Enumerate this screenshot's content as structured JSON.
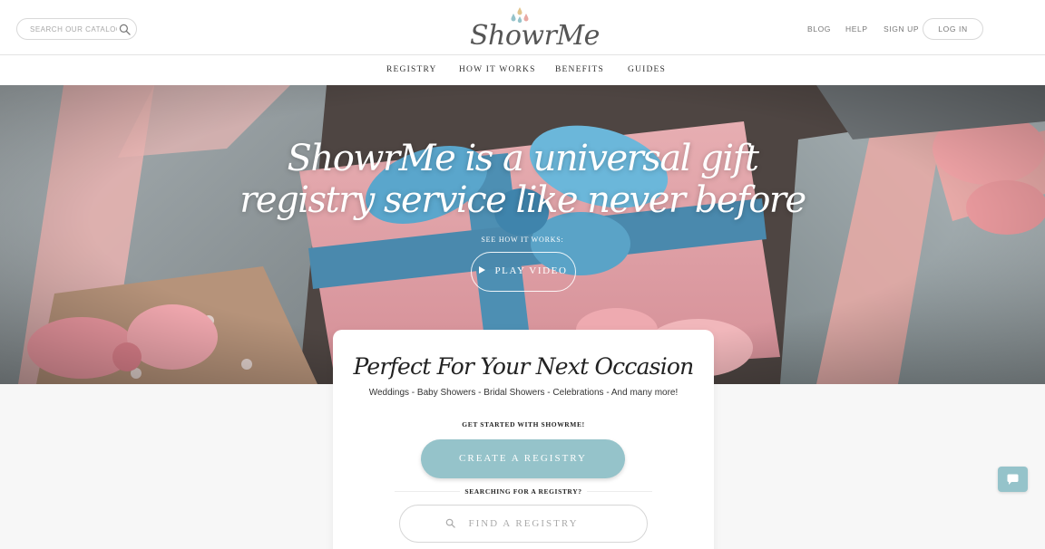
{
  "header": {
    "search_placeholder": "SEARCH OUR CATALOG",
    "logo_text": "ShowrMe",
    "links": [
      "BLOG",
      "HELP",
      "SIGN UP"
    ],
    "login_label": "LOG IN"
  },
  "subnav": [
    "REGISTRY",
    "HOW IT WORKS",
    "BENEFITS",
    "GUIDES"
  ],
  "hero": {
    "title_line1": "ShowrMe is a universal gift",
    "title_line2": "registry service like never before",
    "sub": "SEE HOW IT WORKS:",
    "play_label": "PLAY VIDEO"
  },
  "card": {
    "title": "Perfect For Your Next Occasion",
    "subtitle": "Weddings - Baby Showers - Bridal Showers - Celebrations - And many more!",
    "get_started": "GET STARTED WITH SHOWRME!",
    "create_label": "CREATE A REGISTRY",
    "searching": "SEARCHING FOR A REGISTRY?",
    "find_label": "FIND A REGISTRY"
  },
  "colors": {
    "accent": "#95c3ca",
    "drop_teal": "#95c3ca",
    "drop_pink": "#e8a9a3",
    "drop_gold": "#e2c48d"
  },
  "icons": [
    "search-icon",
    "logo-drops-icon",
    "play-icon",
    "search-icon",
    "chat-icon"
  ]
}
